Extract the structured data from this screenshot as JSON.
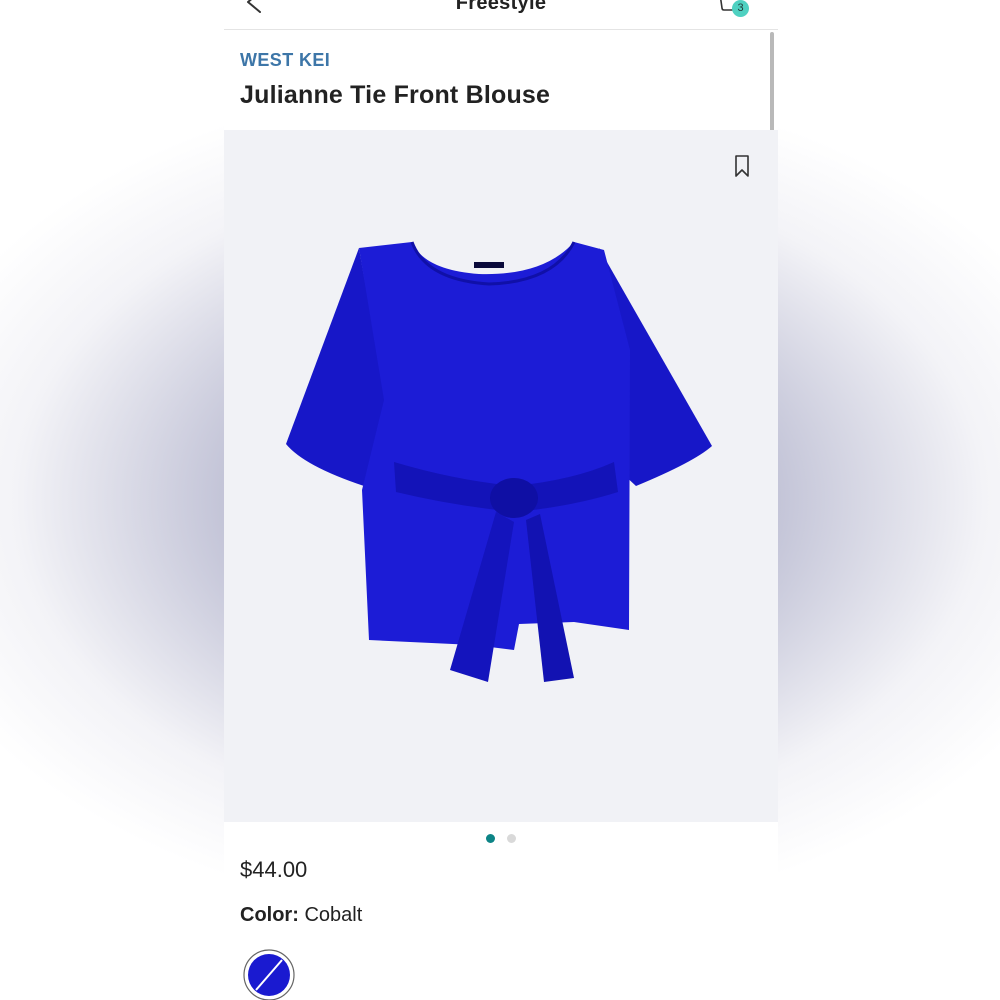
{
  "header": {
    "title": "Freestyle",
    "back_icon": "chevron-left-icon",
    "cart_icon": "shopping-bag-icon",
    "cart_count": "3"
  },
  "product": {
    "brand": "WEST KEI",
    "name": "Julianne Tie Front Blouse",
    "price": "$44.00",
    "color_label": "Color:",
    "color_value": "Cobalt",
    "garment_color": "#1a1ad0",
    "image_description_icon": "blouse-image",
    "save_icon": "bookmark-icon"
  },
  "gallery": {
    "image_count": 2,
    "active_index": 0
  },
  "colors": {
    "brand_text": "#3d76a8",
    "badge": "#4fd1c1",
    "active_dot": "#0d8486",
    "swatch": "#1a1ad0"
  }
}
